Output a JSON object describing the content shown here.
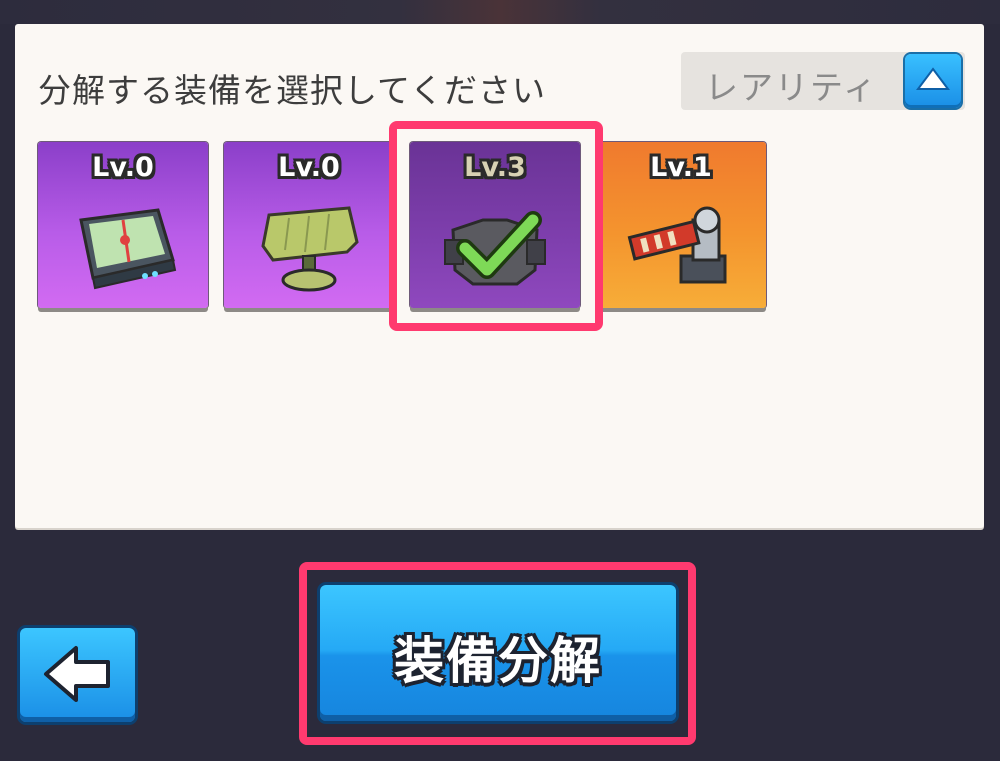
{
  "panel": {
    "instruction": "分解する装備を選択してください",
    "sort": {
      "label": "レアリティ",
      "button_icon": "triangle-up-icon"
    }
  },
  "equipment": [
    {
      "level": "Lv.0",
      "rarity_color": "#b85ce8",
      "item_icon": "tablet-device-icon",
      "selected": false
    },
    {
      "level": "Lv.0",
      "rarity_color": "#b85ce8",
      "item_icon": "shield-antenna-icon",
      "selected": false
    },
    {
      "level": "Lv.3",
      "rarity_color": "#7f3fae",
      "item_icon": "armor-checkmark-icon",
      "selected": true
    },
    {
      "level": "Lv.1",
      "rarity_color": "#f4942e",
      "item_icon": "cannon-turret-icon",
      "selected": false
    }
  ],
  "actions": {
    "dismantle_label": "装備分解",
    "back_icon": "arrow-left-icon"
  },
  "colors": {
    "highlight": "#ff3a6f",
    "button_blue": "#25a9f5",
    "background": "#2b2a3b",
    "panel": "#fbf8f4"
  }
}
